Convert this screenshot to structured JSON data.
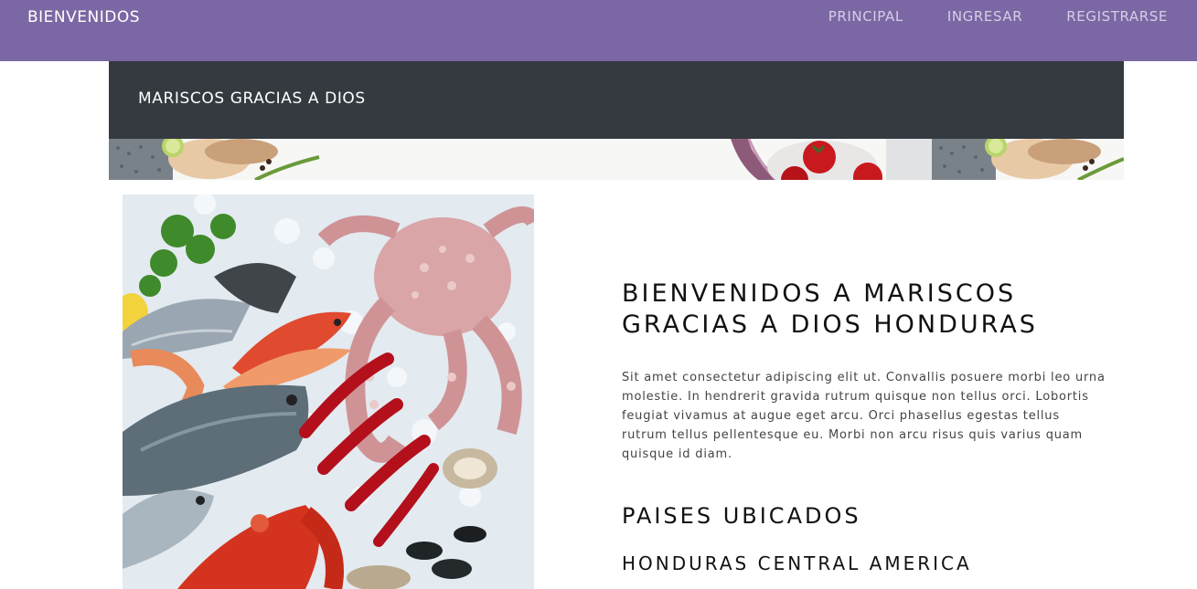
{
  "navbar": {
    "brand": "BIENVENIDOS",
    "links": [
      "PRINCIPAL",
      "INGRESAR",
      "REGISTRARSE"
    ]
  },
  "header": {
    "site_title": "MARISCOS GRACIAS A DIOS"
  },
  "main": {
    "welcome_heading": "BIENVENIDOS A MARISCOS GRACIAS A DIOS HONDURAS",
    "intro_text": "Sit amet consectetur adipiscing elit ut. Convallis posuere morbi leo urna molestie. In hendrerit gravida rutrum quisque non tellus orci. Lobortis feugiat vivamus at augue eget arcu. Orci phasellus egestas tellus rutrum tellus pellentesque eu. Morbi non arcu risus quis varius quam quisque id diam.",
    "countries_heading": "PAISES UBICADOS",
    "country": "HONDURAS CENTRAL AMERICA"
  },
  "colors": {
    "navbar_bg": "#7b67a3",
    "titlebar_bg": "#343a40"
  }
}
